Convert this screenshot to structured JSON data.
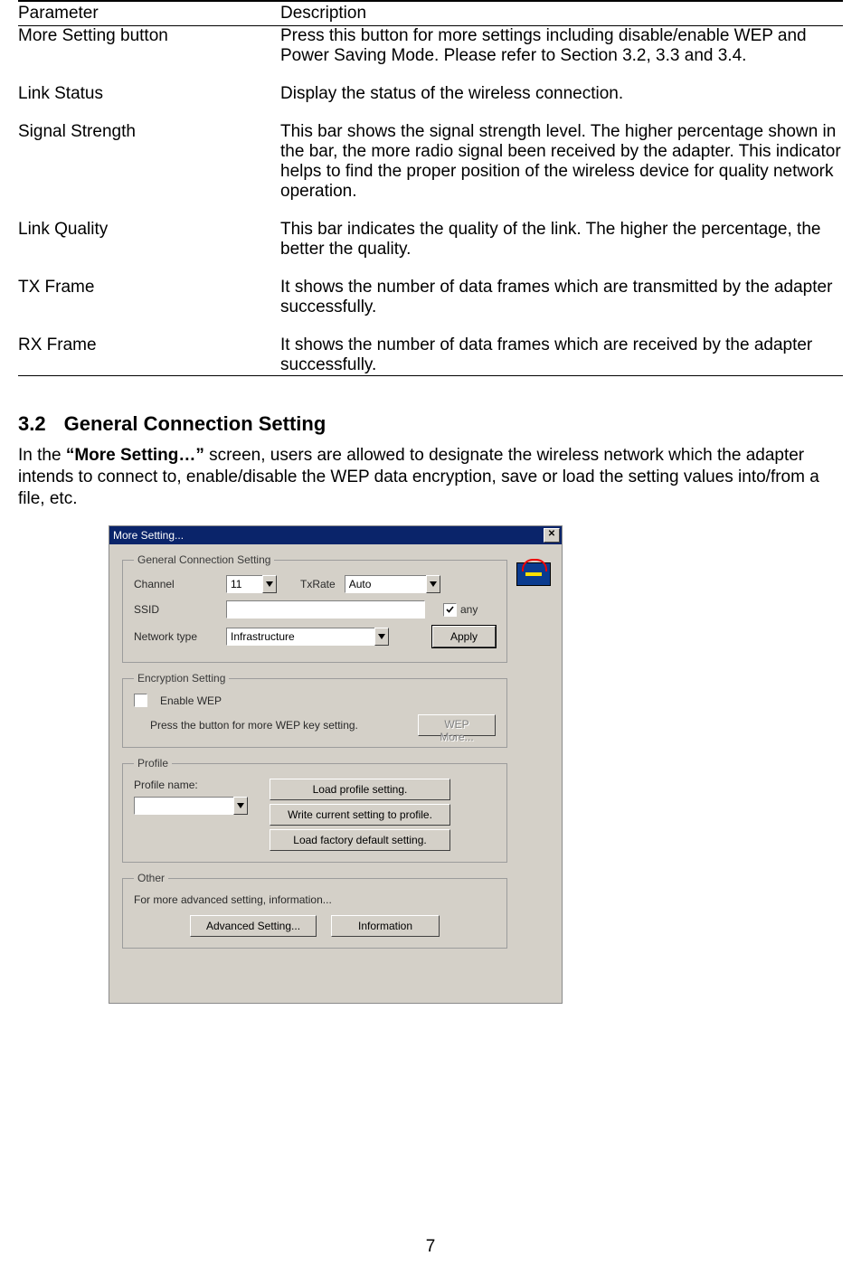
{
  "table": {
    "head_param": "Parameter",
    "head_desc": "Description",
    "rows": [
      {
        "param": "More Setting button",
        "desc": "Press this button for more settings including disable/enable WEP and Power Saving Mode. Please refer to Section 3.2, 3.3 and 3.4."
      },
      {
        "param": "Link Status",
        "desc": "Display the status of the wireless connection."
      },
      {
        "param": "Signal Strength",
        "desc": "This bar shows the signal strength level. The higher percentage shown in the bar, the more radio signal been received by the adapter. This indicator helps to find the proper position of the wireless device for quality network operation."
      },
      {
        "param": "Link Quality",
        "desc": "This bar indicates the quality of the link. The higher the percentage, the better the quality."
      },
      {
        "param": "TX Frame",
        "desc": "It shows the number of data frames which are transmitted by the adapter successfully."
      },
      {
        "param": "RX Frame",
        "desc": "It shows the number of data frames which are received by the adapter successfully."
      }
    ]
  },
  "section": {
    "number": "3.2",
    "title": "General Connection Setting",
    "para_a": "In the ",
    "para_bold": "“More Setting…”",
    "para_b": " screen, users are allowed to designate the wireless network which the adapter intends to connect to, enable/disable the WEP data encryption, save or load the setting values into/from a file, etc."
  },
  "dialog": {
    "title": "More Setting...",
    "groups": {
      "general": {
        "legend": "General Connection Setting",
        "channel_label": "Channel",
        "channel_value": "11",
        "txrate_label": "TxRate",
        "txrate_value": "Auto",
        "ssid_label": "SSID",
        "ssid_value": "",
        "any_label": "any",
        "nettype_label": "Network type",
        "nettype_value": "Infrastructure",
        "apply_label": "Apply"
      },
      "encryption": {
        "legend": "Encryption Setting",
        "enable_wep_label": "Enable WEP",
        "hint": "Press the button for more WEP key setting.",
        "wep_more_label": "WEP More..."
      },
      "profile": {
        "legend": "Profile",
        "name_label": "Profile name:",
        "name_value": "",
        "load_btn": "Load profile setting.",
        "write_btn": "Write current setting to profile.",
        "factory_btn": "Load factory default setting."
      },
      "other": {
        "legend": "Other",
        "hint": "For more advanced setting, information...",
        "adv_btn": "Advanced Setting...",
        "info_btn": "Information"
      }
    }
  },
  "page_number": "7"
}
